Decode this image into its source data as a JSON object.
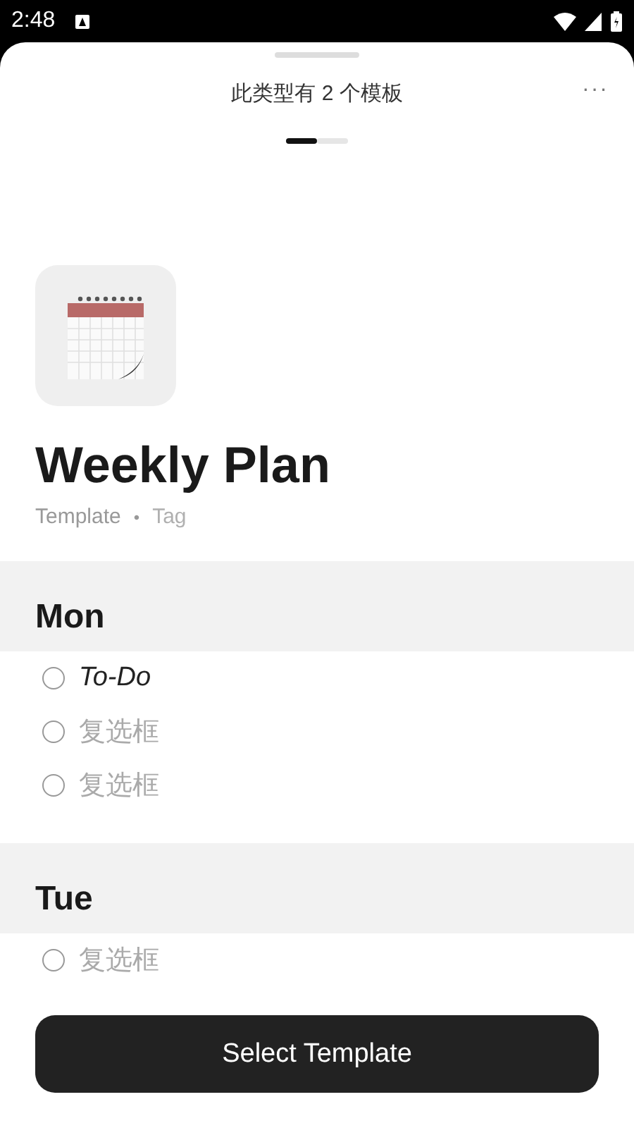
{
  "status_bar": {
    "time": "2:48"
  },
  "header": {
    "title": "此类型有 2 个模板",
    "menu": "···"
  },
  "pager": [
    {
      "selected": true
    },
    {
      "selected": false
    }
  ],
  "template": {
    "name": "Weekly Plan",
    "type": "Template",
    "separator": "•",
    "tag": "Tag"
  },
  "sections": [
    {
      "day": "Mon",
      "items": [
        {
          "text": "To-Do",
          "filled": true,
          "checked": false
        },
        {
          "text": "复选框",
          "filled": false,
          "checked": false
        },
        {
          "text": "复选框",
          "filled": false,
          "checked": false
        }
      ]
    },
    {
      "day": "Tue",
      "items": [
        {
          "text": "复选框",
          "filled": false,
          "checked": false
        }
      ]
    }
  ],
  "button": "Select Template"
}
